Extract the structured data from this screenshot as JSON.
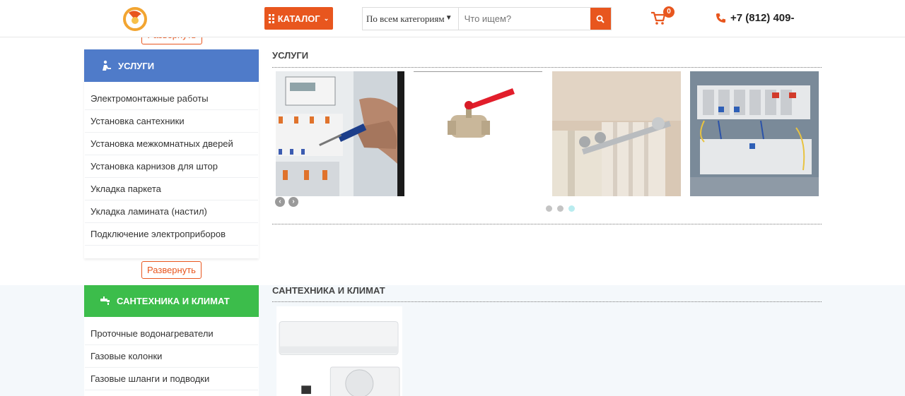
{
  "header": {
    "catalog_label": "КАТАЛОГ",
    "category_select": "По всем категориям",
    "search_placeholder": "Что ищем?",
    "cart_count": "0",
    "phone": "+7 (812) 409-"
  },
  "colors": {
    "accent": "#e8561e",
    "services_blue": "#4f7bc9",
    "plumbing_green": "#3cbd4b"
  },
  "sidebar": {
    "expand_top_label": "Развернуть",
    "services": {
      "title": "УСЛУГИ",
      "icon": "worker-icon",
      "items": [
        "Электромонтажные работы",
        "Установка сантехники",
        "Установка межкомнатных дверей",
        "Установка карнизов для штор",
        "Укладка паркета",
        "Укладка ламината (настил)",
        "Подключение электроприборов"
      ],
      "expand_label": "Развернуть"
    },
    "plumbing": {
      "title": "САНТЕХНИКА И КЛИМАТ",
      "icon": "faucet-icon",
      "items": [
        "Проточные водонагреватели",
        "Газовые колонки",
        "Газовые шланги и подводки"
      ]
    }
  },
  "main": {
    "services_title": "УСЛУГИ",
    "services_carousel": {
      "tiles": [
        "electric-panel-image",
        "ball-valve-image",
        "curtain-rod-image",
        "breaker-box-image"
      ],
      "prev_glyph": "‹",
      "next_glyph": "›",
      "active_dot": 3,
      "dot_count": 3
    },
    "plumbing_title": "САНТЕХНИКА И КЛИМАТ",
    "plumbing_tiles": [
      "air-conditioner-image"
    ]
  }
}
